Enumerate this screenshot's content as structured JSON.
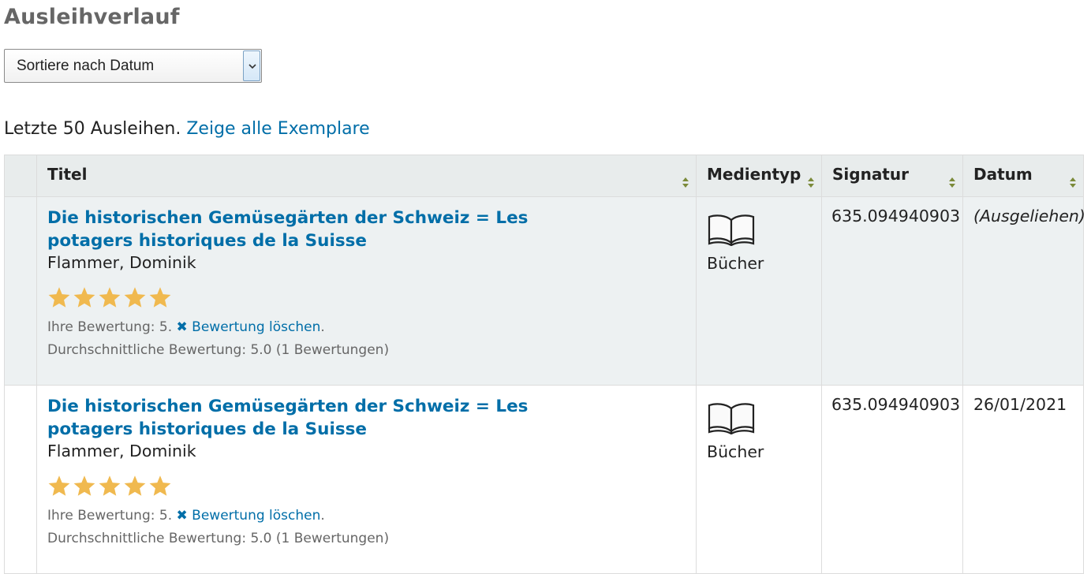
{
  "page": {
    "title": "Ausleihverlauf"
  },
  "sort": {
    "selected": "Sortiere nach Datum"
  },
  "summary": {
    "text": "Letzte 50 Ausleihen. ",
    "link": "Zeige alle Exemplare"
  },
  "table": {
    "headers": {
      "title": "Titel",
      "media_type": "Medientyp",
      "call_number": "Signatur",
      "date": "Datum"
    },
    "rows": [
      {
        "title": "Die historischen Gemüsegärten der Schweiz = Les potagers historiques de la Suisse",
        "author": "Flammer, Dominik",
        "rating_stars": 5,
        "your_rating_text": "Ihre Bewertung: 5. ",
        "delete_rating_link": "Bewertung löschen",
        "delete_rating_suffix": ".",
        "average_rating": "Durchschnittliche Bewertung: 5.0 (1 Bewertungen)",
        "media_type": "Bücher",
        "media_icon": "book-icon",
        "call_number": "635.094940903",
        "date": "(Ausgeliehen)"
      },
      {
        "title": "Die historischen Gemüsegärten der Schweiz = Les potagers historiques de la Suisse",
        "author": "Flammer, Dominik",
        "rating_stars": 5,
        "your_rating_text": "Ihre Bewertung: 5. ",
        "delete_rating_link": "Bewertung löschen",
        "delete_rating_suffix": ".",
        "average_rating": "Durchschnittliche Bewertung: 5.0 (1 Bewertungen)",
        "media_type": "Bücher",
        "media_icon": "book-icon",
        "call_number": "635.094940903",
        "date": "26/01/2021"
      }
    ]
  },
  "colors": {
    "link": "#006ea8",
    "star": "#f0b94f",
    "header_bg": "#e8ecec",
    "row_alt_bg": "#edf1f2"
  }
}
